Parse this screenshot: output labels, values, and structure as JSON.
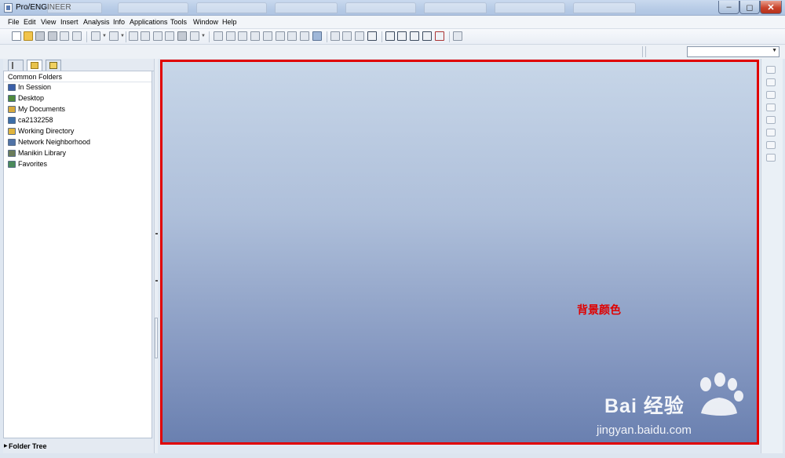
{
  "window": {
    "title": "Pro/ENGINEER"
  },
  "menu": {
    "items": [
      "File",
      "Edit",
      "View",
      "Insert",
      "Analysis",
      "Info",
      "Applications",
      "Tools",
      "Window",
      "Help"
    ]
  },
  "toolbar": {
    "icons": [
      "new-icon",
      "open-icon",
      "save-icon",
      "print-icon",
      "copy-icon",
      "paste-icon",
      "undo-icon",
      "redo-icon",
      "cut-icon",
      "copy-icon",
      "paste-icon",
      "paste-special-icon",
      "regenerate-icon",
      "select-box-icon",
      "repaint-icon",
      "spin-center-icon",
      "orient-icon",
      "zoom-in-icon",
      "zoom-out-icon",
      "refit-icon",
      "reorient-icon",
      "saved-views-icon",
      "layers-icon",
      "wireframe-icon",
      "hidden-line-icon",
      "no-hidden-icon",
      "shading-icon",
      "datum-planes-icon",
      "datum-axes-icon",
      "datum-points-icon",
      "coordinate-systems-icon",
      "annotations-icon",
      "context-help-icon"
    ]
  },
  "navigator": {
    "section_title": "Common Folders",
    "items": [
      {
        "label": "In Session",
        "icon": "in-session-icon",
        "color": "#3a5fa8"
      },
      {
        "label": "Desktop",
        "icon": "desktop-icon",
        "color": "#4f8a3c"
      },
      {
        "label": "My Documents",
        "icon": "my-documents-icon",
        "color": "#d7a93c"
      },
      {
        "label": "ca2132258",
        "icon": "computer-icon",
        "color": "#3b6ea8"
      },
      {
        "label": "Working Directory",
        "icon": "working-directory-icon",
        "color": "#e0b43d"
      },
      {
        "label": "Network Neighborhood",
        "icon": "network-icon",
        "color": "#5073a6"
      },
      {
        "label": "Manikin Library",
        "icon": "manikin-library-icon",
        "color": "#6a7c5a"
      },
      {
        "label": "Favorites",
        "icon": "favorites-icon",
        "color": "#4a8a5a"
      }
    ],
    "footer_label": "Folder Tree"
  },
  "graphics": {
    "annotation": "背景颜色",
    "border_color": "#e00000"
  },
  "watermark": {
    "brand": "Bai 经验",
    "url": "jingyan.baidu.com"
  }
}
